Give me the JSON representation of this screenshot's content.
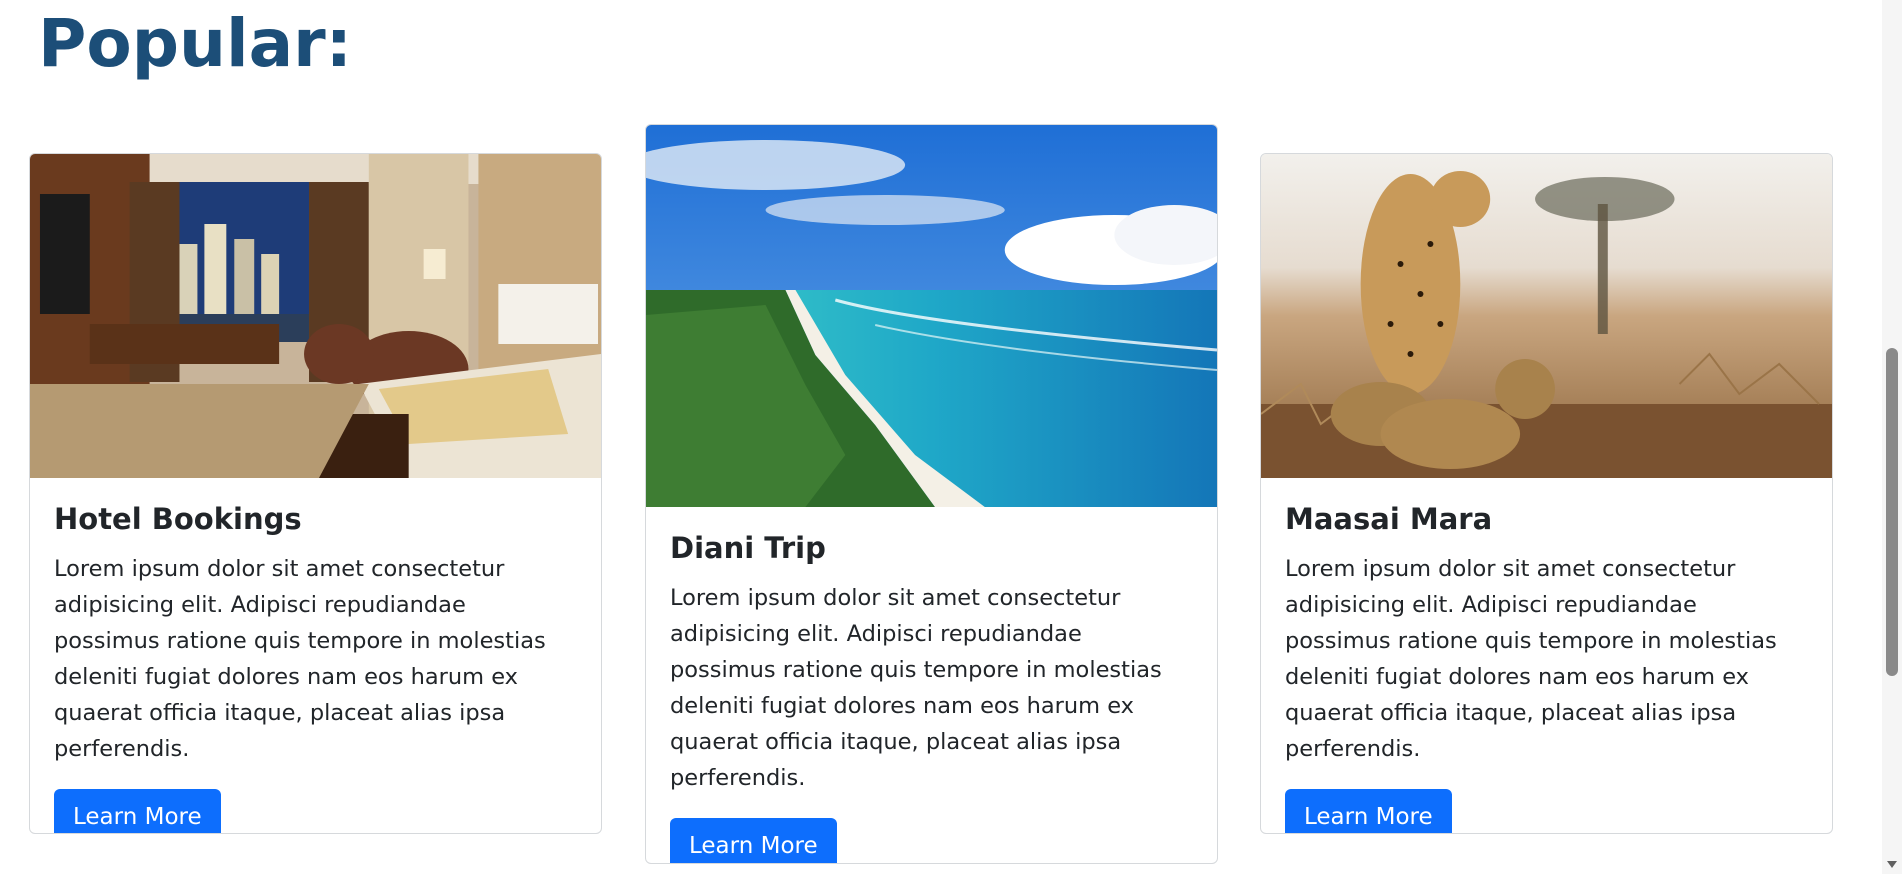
{
  "section": {
    "title": "Popular:"
  },
  "cards": [
    {
      "image_label": "hotel-room-photo",
      "title": "Hotel Bookings",
      "text": "Lorem ipsum dolor sit amet consectetur adipisicing elit. Adipisci repudiandae possimus ratione quis tempore in molestias deleniti fugiat dolores nam eos harum ex quaerat officia itaque, placeat alias ipsa perferendis.",
      "button_label": "Learn More"
    },
    {
      "image_label": "beach-aerial-photo",
      "title": "Diani Trip",
      "text": "Lorem ipsum dolor sit amet consectetur adipisicing elit. Adipisci repudiandae possimus ratione quis tempore in molestias deleniti fugiat dolores nam eos harum ex quaerat officia itaque, placeat alias ipsa perferendis.",
      "button_label": "Learn More"
    },
    {
      "image_label": "cheetah-savanna-photo",
      "title": "Maasai Mara",
      "text": "Lorem ipsum dolor sit amet consectetur adipisicing elit. Adipisci repudiandae possimus ratione quis tempore in molestias deleniti fugiat dolores nam eos harum ex quaerat officia itaque, placeat alias ipsa perferendis.",
      "button_label": "Learn More"
    }
  ],
  "colors": {
    "title": "#1c4e78",
    "button": "#0d6efd"
  }
}
